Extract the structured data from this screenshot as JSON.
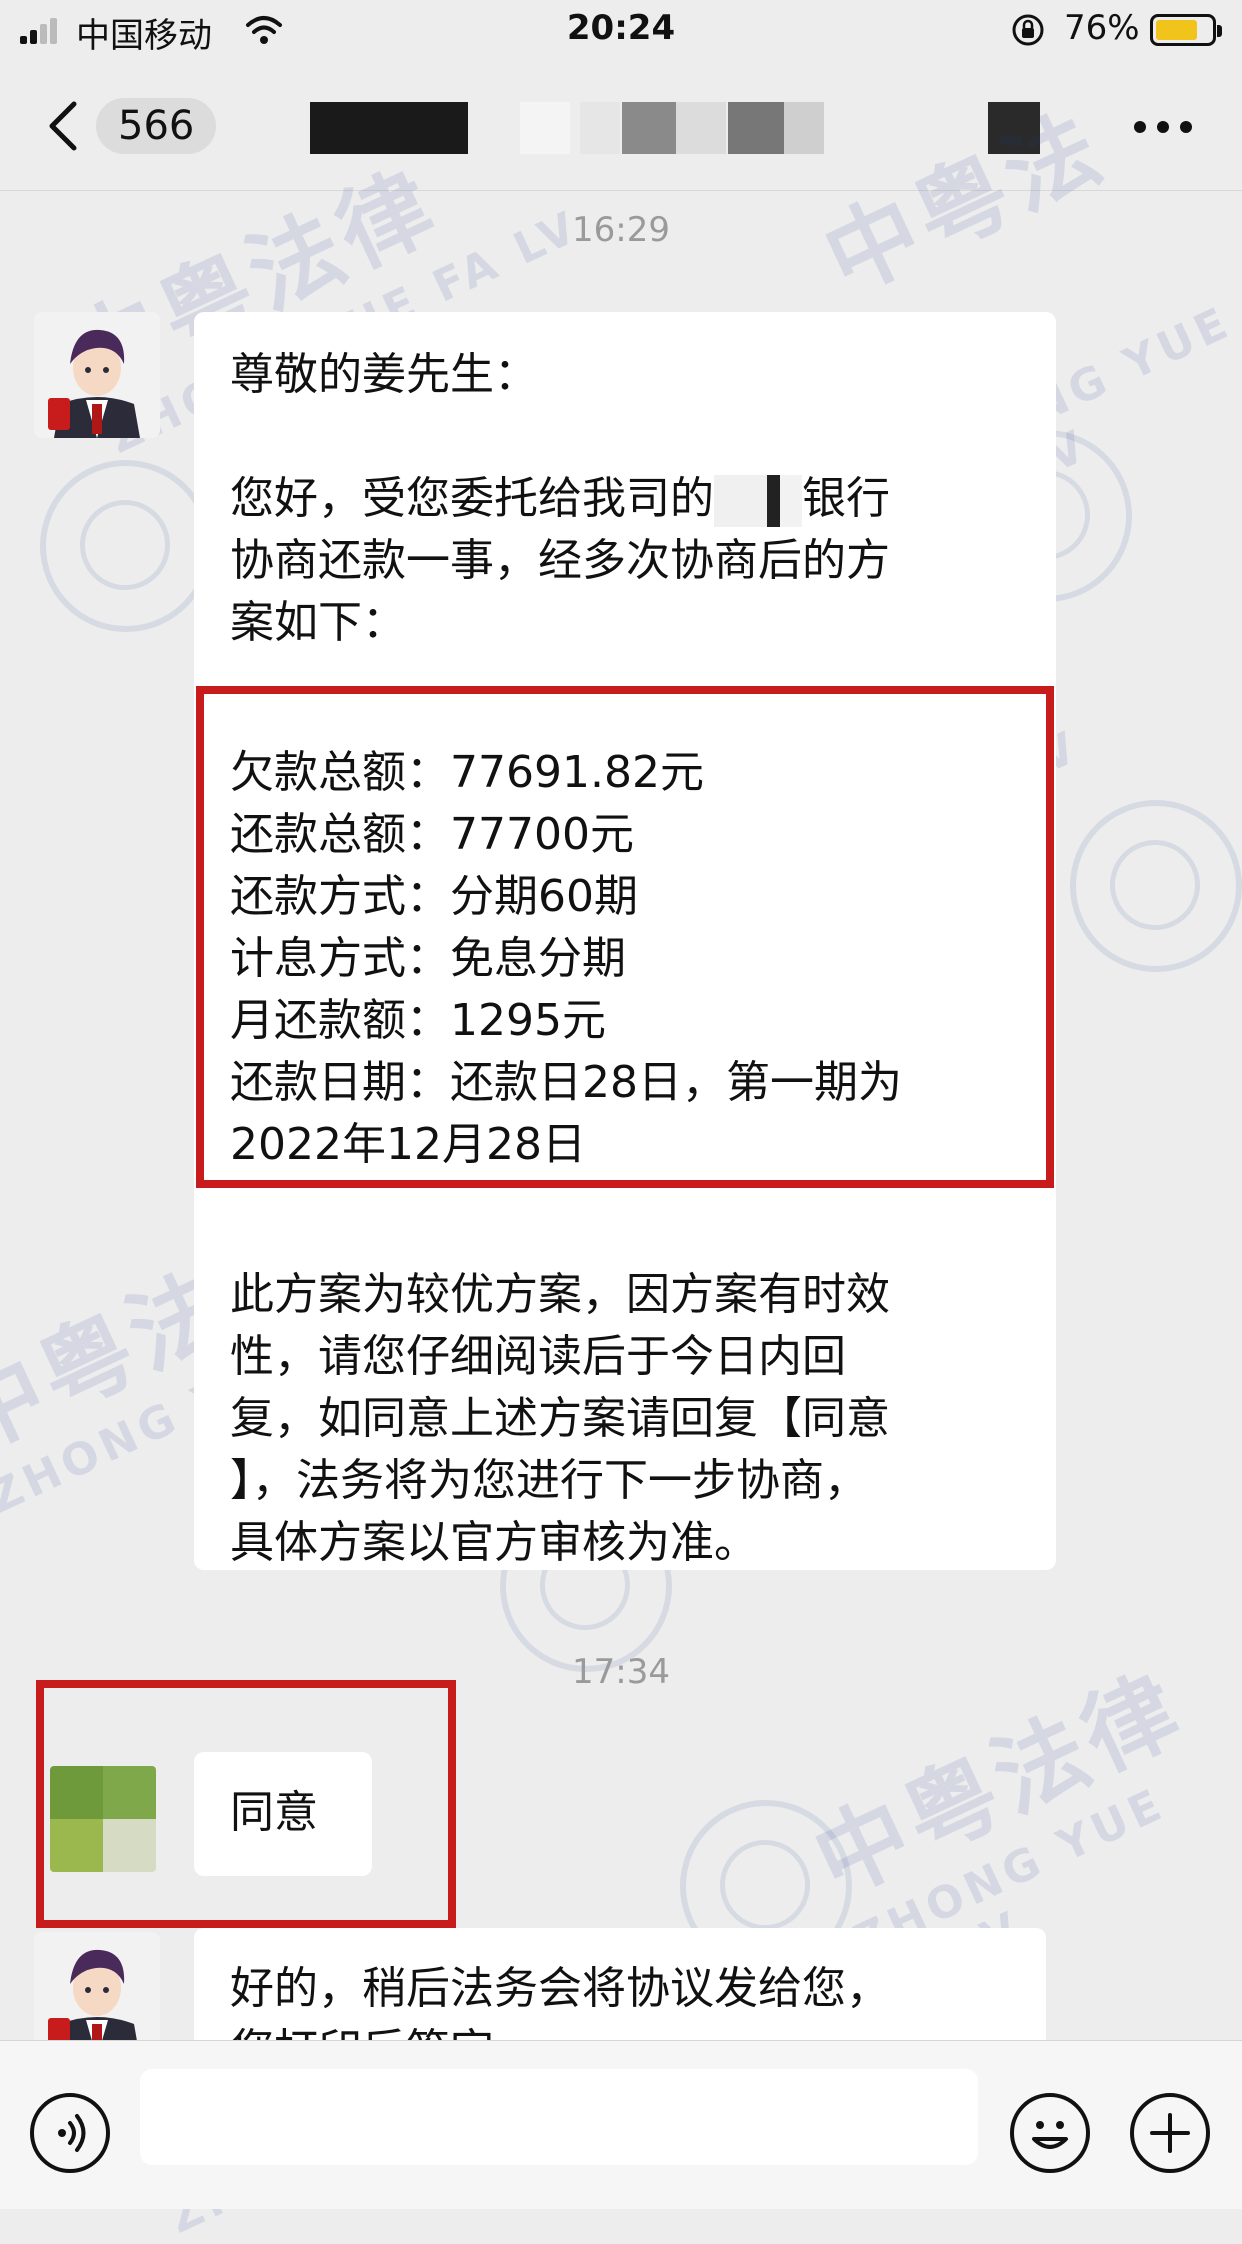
{
  "status_bar": {
    "carrier": "中国移动",
    "time": "20:24",
    "battery": "76%",
    "battery_level": 0.76
  },
  "nav": {
    "unread_count": "566",
    "back_icon": "chevron-left-icon",
    "more_icon": "more-dots-icon"
  },
  "watermark": {
    "cn": "中粤法律",
    "en": "ZHONG YUE FA LV"
  },
  "messages": {
    "time_1": "16:29",
    "msg1": {
      "greeting": "尊敬的姜先生：",
      "intro_a": "您好，受您委托给我司的",
      "intro_b": "银行",
      "intro_c": "协商还款一事，经多次协商后的方",
      "intro_d": "案如下：",
      "plan": [
        "欠款总额：77691.82元",
        "还款总额：77700元",
        "还款方式：分期60期",
        "计息方式：免息分期",
        "月还款额：1295元",
        "还款日期：还款日28日，第一期为",
        "2022年12月28日"
      ],
      "note": [
        "此方案为较优方案，因方案有时效",
        "性，请您仔细阅读后于今日内回",
        "复，如同意上述方案请回复【同意",
        "】，法务将为您进行下一步协商，",
        "具体方案以官方审核为准。"
      ]
    },
    "time_2": "17:34",
    "msg2": "同意",
    "msg3": {
      "line1": "好的，稍后法务会将协议发给您，",
      "line2": "您打印后签字"
    }
  },
  "colors": {
    "accent_red": "#c81b1b",
    "battery_yellow": "#f0c41b"
  }
}
